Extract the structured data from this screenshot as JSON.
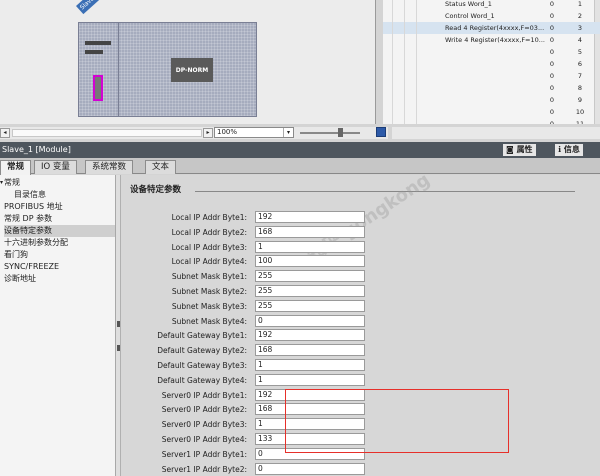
{
  "device": {
    "tag": "Slave_...",
    "module_label": "DP-NORM"
  },
  "io_table": {
    "rows": [
      {
        "name": "Status Word_1",
        "v1": "0",
        "v2": "1",
        "selected": false
      },
      {
        "name": "Control Word_1",
        "v1": "0",
        "v2": "2",
        "selected": false
      },
      {
        "name": "Read 4 Register(4xxxx,F=03...",
        "v1": "0",
        "v2": "3",
        "selected": true
      },
      {
        "name": "Write 4 Register(4xxxx,F=10...",
        "v1": "0",
        "v2": "4",
        "selected": false
      },
      {
        "name": "",
        "v1": "0",
        "v2": "5",
        "selected": false
      },
      {
        "name": "",
        "v1": "0",
        "v2": "6",
        "selected": false
      },
      {
        "name": "",
        "v1": "0",
        "v2": "7",
        "selected": false
      },
      {
        "name": "",
        "v1": "0",
        "v2": "8",
        "selected": false
      },
      {
        "name": "",
        "v1": "0",
        "v2": "9",
        "selected": false
      },
      {
        "name": "",
        "v1": "0",
        "v2": "10",
        "selected": false
      },
      {
        "name": "",
        "v1": "0",
        "v2": "11",
        "selected": false
      }
    ]
  },
  "zoom": {
    "value": "100%"
  },
  "title_bar": {
    "title": "Slave_1 [Module]",
    "properties_label": "属性",
    "info_label": "信息"
  },
  "tabs": [
    {
      "label": "常规",
      "active": true
    },
    {
      "label": "IO 变量",
      "active": false
    },
    {
      "label": "系统常数",
      "active": false
    },
    {
      "label": "文本",
      "active": false
    }
  ],
  "nav": {
    "items": [
      {
        "label": "常规",
        "indent": 1,
        "selected": false,
        "expander": true
      },
      {
        "label": "目录信息",
        "indent": 2,
        "selected": false,
        "expander": false
      },
      {
        "label": "PROFIBUS 地址",
        "indent": 1,
        "selected": false,
        "expander": false
      },
      {
        "label": "常规 DP 参数",
        "indent": 1,
        "selected": false,
        "expander": false
      },
      {
        "label": "设备特定参数",
        "indent": 1,
        "selected": true,
        "expander": false
      },
      {
        "label": "十六进制参数分配",
        "indent": 1,
        "selected": false,
        "expander": false
      },
      {
        "label": "看门狗",
        "indent": 1,
        "selected": false,
        "expander": false
      },
      {
        "label": "SYNC/FREEZE",
        "indent": 1,
        "selected": false,
        "expander": false
      },
      {
        "label": "诊断地址",
        "indent": 1,
        "selected": false,
        "expander": false
      }
    ]
  },
  "params": {
    "section_title": "设备特定参数",
    "watermark": "知乎 gongkong",
    "rows": [
      {
        "label": "Local IP Addr Byte1:",
        "value": "192"
      },
      {
        "label": "Local IP Addr Byte2:",
        "value": "168"
      },
      {
        "label": "Local IP Addr Byte3:",
        "value": "1"
      },
      {
        "label": "Local IP Addr Byte4:",
        "value": "100"
      },
      {
        "label": "Subnet Mask Byte1:",
        "value": "255"
      },
      {
        "label": "Subnet Mask Byte2:",
        "value": "255"
      },
      {
        "label": "Subnet Mask Byte3:",
        "value": "255"
      },
      {
        "label": "Subnet Mask Byte4:",
        "value": "0"
      },
      {
        "label": "Default Gateway Byte1:",
        "value": "192"
      },
      {
        "label": "Default Gateway Byte2:",
        "value": "168"
      },
      {
        "label": "Default Gateway Byte3:",
        "value": "1"
      },
      {
        "label": "Default Gateway Byte4:",
        "value": "1"
      },
      {
        "label": "Server0 IP Addr Byte1:",
        "value": "192"
      },
      {
        "label": "Server0 IP Addr Byte2:",
        "value": "168"
      },
      {
        "label": "Server0 IP Addr Byte3:",
        "value": "1"
      },
      {
        "label": "Server0 IP Addr Byte4:",
        "value": "133"
      },
      {
        "label": "Server1 IP Addr Byte1:",
        "value": "0"
      },
      {
        "label": "Server1 IP Addr Byte2:",
        "value": "0"
      }
    ]
  },
  "colors": {
    "highlight": "#e6302a",
    "title_bar_bg": "#4e565e",
    "connector": "#d400d4"
  }
}
